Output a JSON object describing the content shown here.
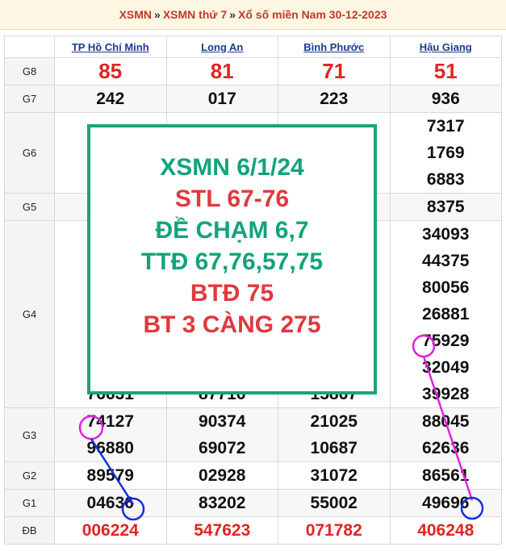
{
  "breadcrumb": {
    "items": [
      "XSMN",
      "XSMN thứ 7",
      "Xổ số miền Nam 30-12-2023"
    ],
    "separator": "»"
  },
  "provinces": [
    "TP Hồ Chí Minh",
    "Long An",
    "Bình Phước",
    "Hậu Giang"
  ],
  "rows": [
    {
      "label": "G8",
      "cols": [
        [
          "85"
        ],
        [
          "81"
        ],
        [
          "71"
        ],
        [
          "51"
        ]
      ]
    },
    {
      "label": "G7",
      "cols": [
        [
          "242"
        ],
        [
          "017"
        ],
        [
          "223"
        ],
        [
          "936"
        ]
      ]
    },
    {
      "label": "G6",
      "cols": [
        [],
        [],
        [],
        [
          "7317",
          "1769",
          "6883"
        ]
      ]
    },
    {
      "label": "G5",
      "cols": [
        [],
        [],
        [],
        [
          "8375"
        ]
      ]
    },
    {
      "label": "G4",
      "cols": [
        [
          "",
          "",
          "",
          "",
          "",
          "",
          "76631"
        ],
        [
          "",
          "",
          "",
          "",
          "",
          "",
          "87716"
        ],
        [
          "",
          "",
          "",
          "",
          "",
          "",
          "15867"
        ],
        [
          "34093",
          "44375",
          "80056",
          "26881",
          "75929",
          "32049",
          "39928"
        ]
      ]
    },
    {
      "label": "G3",
      "cols": [
        [
          "74127",
          "96880"
        ],
        [
          "90374",
          "69072"
        ],
        [
          "21025",
          "10687"
        ],
        [
          "88045",
          "62636"
        ]
      ]
    },
    {
      "label": "G2",
      "cols": [
        [
          "89579"
        ],
        [
          "02928"
        ],
        [
          "31072"
        ],
        [
          "86561"
        ]
      ]
    },
    {
      "label": "G1",
      "cols": [
        [
          "04636"
        ],
        [
          "83202"
        ],
        [
          "55002"
        ],
        [
          "49696"
        ]
      ]
    },
    {
      "label": "ĐB",
      "cols": [
        [
          "006224"
        ],
        [
          "547623"
        ],
        [
          "071782"
        ],
        [
          "406248"
        ]
      ]
    }
  ],
  "overlay": {
    "lines": [
      {
        "text": "XSMN 6/1/24",
        "color": "#13a37a"
      },
      {
        "text": "STL 67-76",
        "color": "#e0393e"
      },
      {
        "text": "ĐỀ CHẠM 6,7",
        "color": "#13a37a"
      },
      {
        "text": "TTĐ 67,76,57,75",
        "color": "#13a37a"
      },
      {
        "text": "BTĐ 75",
        "color": "#e0393e"
      },
      {
        "text": "BT 3 CÀNG 275",
        "color": "#e0393e"
      }
    ]
  },
  "colors": {
    "header_link": "#c0392b",
    "province_link": "#1a3a8f",
    "g8_and_special": "#e02424",
    "overlay_border": "#1aa37a",
    "annotation_magenta": "#e020e0",
    "annotation_blue": "#1530d8"
  }
}
